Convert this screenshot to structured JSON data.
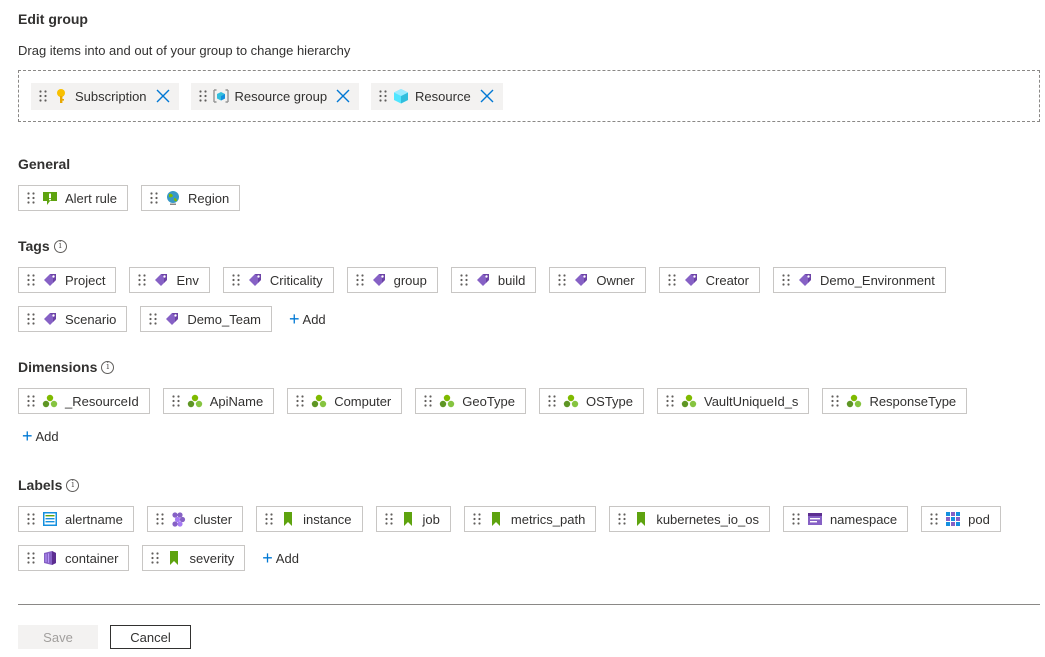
{
  "header": {
    "title": "Edit group",
    "subtitle": "Drag items into and out of your group to change hierarchy"
  },
  "group": [
    {
      "label": "Subscription",
      "icon": "key-icon"
    },
    {
      "label": "Resource group",
      "icon": "resource-group-icon"
    },
    {
      "label": "Resource",
      "icon": "cube-icon"
    }
  ],
  "general": {
    "title": "General",
    "items": [
      {
        "label": "Alert rule",
        "icon": "alert-rule-icon"
      },
      {
        "label": "Region",
        "icon": "globe-icon"
      }
    ]
  },
  "tags": {
    "title": "Tags",
    "info": "i",
    "items": [
      "Project",
      "Env",
      "Criticality",
      "group",
      "build",
      "Owner",
      "Creator",
      "Demo_Environment",
      "Scenario",
      "Demo_Team"
    ],
    "add_label": "Add"
  },
  "dimensions": {
    "title": "Dimensions",
    "info": "i",
    "items": [
      "_ResourceId",
      "ApiName",
      "Computer",
      "GeoType",
      "OSType",
      "VaultUniqueId_s",
      "ResponseType"
    ],
    "add_label": "Add"
  },
  "labels": {
    "title": "Labels",
    "info": "i",
    "items": [
      {
        "label": "alertname",
        "icon": "log-icon"
      },
      {
        "label": "cluster",
        "icon": "cluster-icon"
      },
      {
        "label": "instance",
        "icon": "bookmark-icon"
      },
      {
        "label": "job",
        "icon": "bookmark-icon"
      },
      {
        "label": "metrics_path",
        "icon": "bookmark-icon"
      },
      {
        "label": "kubernetes_io_os",
        "icon": "bookmark-icon"
      },
      {
        "label": "namespace",
        "icon": "namespace-icon"
      },
      {
        "label": "pod",
        "icon": "pod-icon"
      },
      {
        "label": "container",
        "icon": "container-icon"
      },
      {
        "label": "severity",
        "icon": "bookmark-icon"
      }
    ],
    "add_label": "Add"
  },
  "footer": {
    "save_label": "Save",
    "cancel_label": "Cancel"
  },
  "colors": {
    "accent": "#0078d4",
    "tag_purple": "#8661c5",
    "dimension_green": "#7fba00",
    "label_green": "#5ea30f"
  }
}
